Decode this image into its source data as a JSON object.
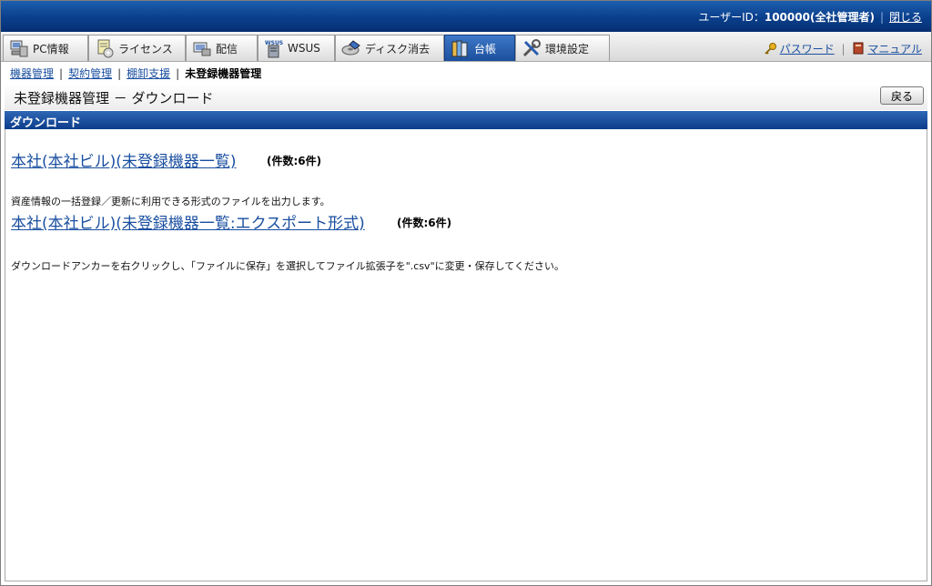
{
  "header": {
    "user_label": "ユーザーID：",
    "user_id": "100000(全社管理者)",
    "logout": "閉じる"
  },
  "tabs": [
    {
      "label": "PC情報",
      "icon": "pc-icon"
    },
    {
      "label": "ライセンス",
      "icon": "license-icon"
    },
    {
      "label": "配信",
      "icon": "distribution-icon"
    },
    {
      "label": "WSUS",
      "icon": "wsus-icon"
    },
    {
      "label": "ディスク消去",
      "icon": "disk-erase-icon"
    },
    {
      "label": "台帳",
      "icon": "ledger-icon",
      "active": true
    },
    {
      "label": "環境設定",
      "icon": "settings-tools-icon"
    }
  ],
  "wsus_icon_text": "WSUS",
  "top_links": {
    "password": "パスワード",
    "manual": "マニュアル"
  },
  "breadcrumb": {
    "items": [
      "機器管理",
      "契約管理",
      "棚卸支援"
    ],
    "current": "未登録機器管理"
  },
  "page": {
    "title": "未登録機器管理 － ダウンロード",
    "back_button": "戻る"
  },
  "section": {
    "title": "ダウンロード",
    "link1_text": "本社(本社ビル)(未登録機器一覧)",
    "link1_count": "(件数:6件)",
    "description1": "資産情報の一括登録／更新に利用できる形式のファイルを出力します。",
    "link2_text": "本社(本社ビル)(未登録機器一覧:エクスポート形式)",
    "link2_count": "(件数:6件)",
    "description2": "ダウンロードアンカーを右クリックし、「ファイルに保存」を選択してファイル拡張子を\".csv\"に変更・保存してください。"
  },
  "colors": {
    "header_blue": "#0a3f8c",
    "link_blue": "#1a4fa0",
    "active_tab": "#1b4f9e"
  }
}
